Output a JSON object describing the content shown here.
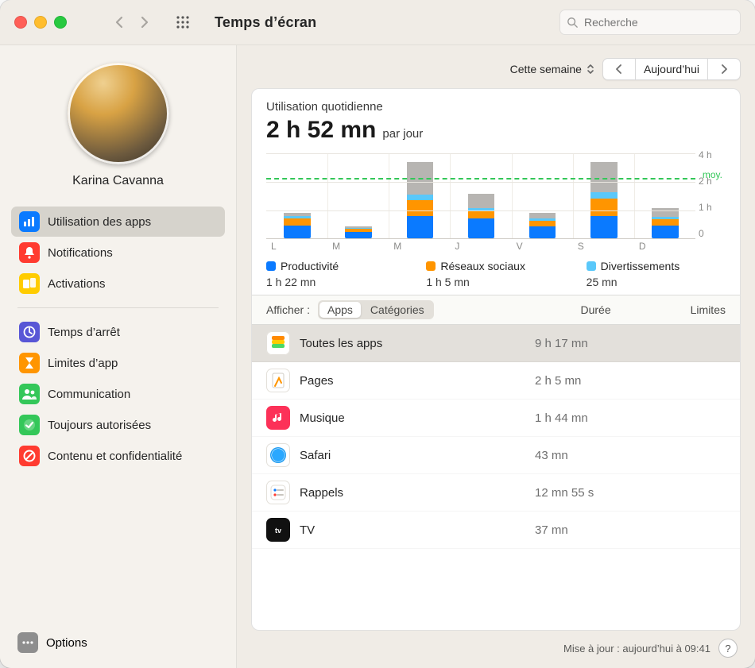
{
  "window": {
    "title": "Temps d’écran"
  },
  "search": {
    "placeholder": "Recherche"
  },
  "user": {
    "name": "Karina Cavanna"
  },
  "sidebar": {
    "groups": [
      [
        {
          "label": "Utilisation des apps",
          "color": "#0a7aff",
          "icon": "bars",
          "selected": true
        },
        {
          "label": "Notifications",
          "color": "#ff3b30",
          "icon": "bell"
        },
        {
          "label": "Activations",
          "color": "#ffcc00",
          "icon": "devices"
        }
      ],
      [
        {
          "label": "Temps d’arrêt",
          "color": "#5856d6",
          "icon": "moon"
        },
        {
          "label": "Limites d’app",
          "color": "#ff9500",
          "icon": "hourglass"
        },
        {
          "label": "Communication",
          "color": "#34c759",
          "icon": "people"
        },
        {
          "label": "Toujours autorisées",
          "color": "#34c759",
          "icon": "check"
        },
        {
          "label": "Contenu et confidentialité",
          "color": "#ff3b30",
          "icon": "nosign"
        }
      ]
    ],
    "options": "Options"
  },
  "period": {
    "label": "Cette semaine",
    "current": "Aujourd’hui"
  },
  "summary": {
    "title": "Utilisation quotidienne",
    "value": "2 h 52 mn",
    "suffix": "par jour"
  },
  "chart_data": {
    "type": "bar",
    "categories": [
      "L",
      "M",
      "M",
      "J",
      "V",
      "S",
      "D"
    ],
    "ylim": [
      0,
      4
    ],
    "yticks": [
      "4 h",
      "2 h",
      "1 h",
      "0"
    ],
    "avg_label": "moy.",
    "avg_value": 2.87,
    "series": [
      {
        "name": "Productivité",
        "color": "#0a7aff",
        "values": [
          1.1,
          0.8,
          1.1,
          1.3,
          1.0,
          1.1,
          1.0
        ]
      },
      {
        "name": "Réseaux sociaux",
        "color": "#ff9500",
        "values": [
          0.6,
          0.4,
          0.8,
          0.5,
          0.5,
          0.9,
          0.5
        ]
      },
      {
        "name": "Divertissements",
        "color": "#5ac8fa",
        "values": [
          0.2,
          0.1,
          0.3,
          0.2,
          0.2,
          0.3,
          0.2
        ]
      },
      {
        "name": "Autre",
        "color": "#b7b5b2",
        "values": [
          0.3,
          0.2,
          1.6,
          0.9,
          0.5,
          1.5,
          0.7
        ]
      }
    ]
  },
  "legend": [
    {
      "name": "Productivité",
      "color": "#0a7aff",
      "value": "1 h 22 mn"
    },
    {
      "name": "Réseaux sociaux",
      "color": "#ff9500",
      "value": "1 h 5 mn"
    },
    {
      "name": "Divertissements",
      "color": "#5ac8fa",
      "value": "25 mn"
    }
  ],
  "table": {
    "filter_label": "Afficher :",
    "tabs": [
      "Apps",
      "Catégories"
    ],
    "col_duration": "Durée",
    "col_limits": "Limites",
    "rows": [
      {
        "name": "Toutes les apps",
        "duration": "9 h 17 mn",
        "icon": "stack",
        "bg": "#ffffff",
        "selected": true
      },
      {
        "name": "Pages",
        "duration": "2 h 5 mn",
        "icon": "pages",
        "bg": "#ffffff"
      },
      {
        "name": "Musique",
        "duration": "1 h 44 mn",
        "icon": "music",
        "bg": "#fc3158"
      },
      {
        "name": "Safari",
        "duration": "43 mn",
        "icon": "safari",
        "bg": "#ffffff"
      },
      {
        "name": "Rappels",
        "duration": "12 mn 55 s",
        "icon": "reminders",
        "bg": "#ffffff"
      },
      {
        "name": "TV",
        "duration": "37 mn",
        "icon": "tv",
        "bg": "#111111"
      }
    ]
  },
  "footer": {
    "updated": "Mise à jour : aujourd’hui à 09:41"
  }
}
